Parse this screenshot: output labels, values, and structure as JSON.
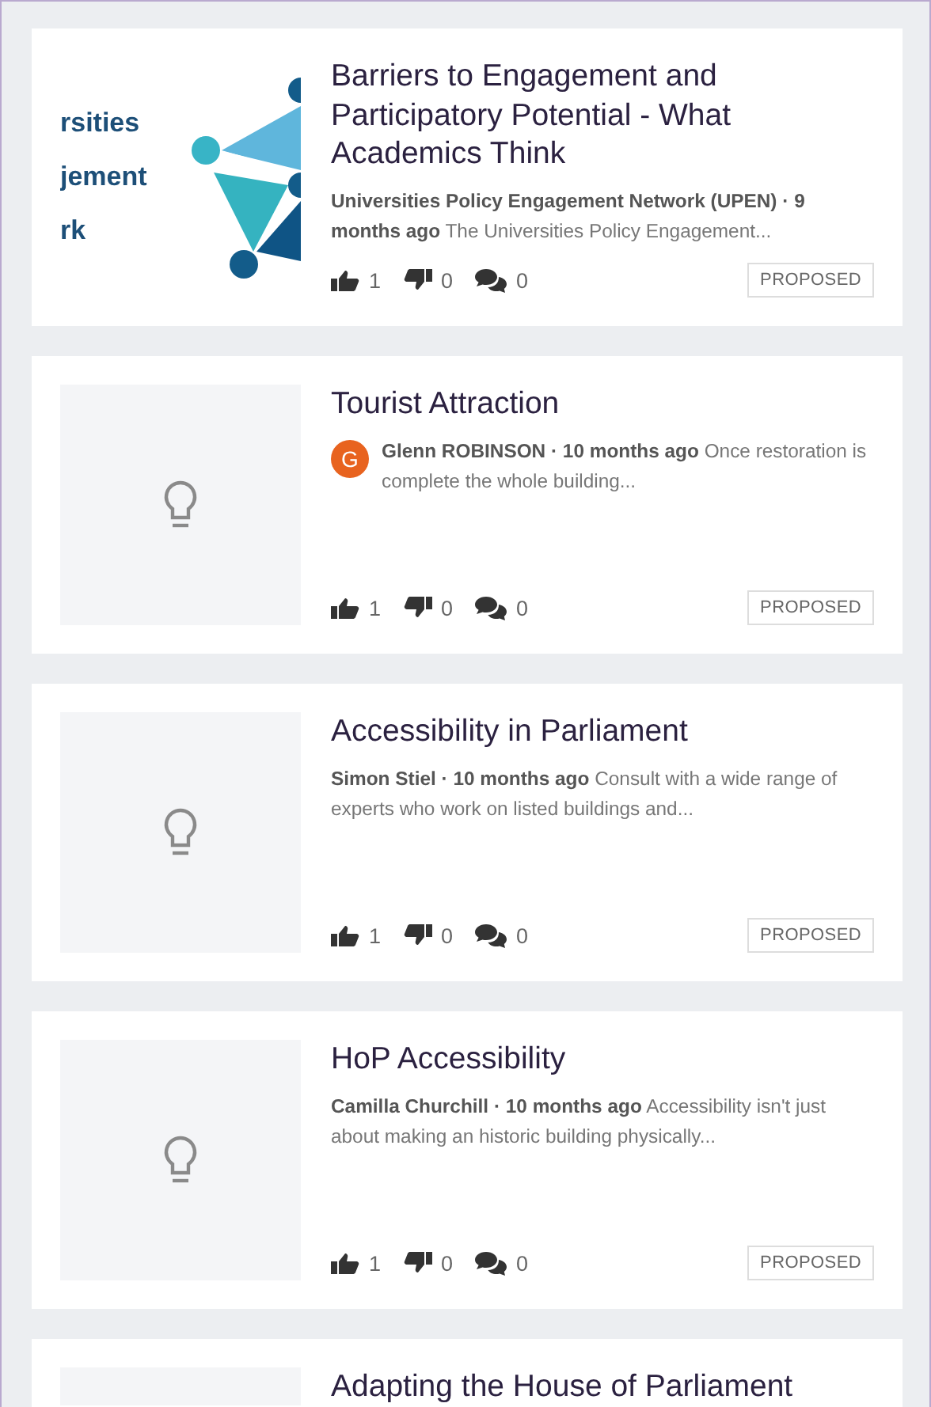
{
  "ideas": [
    {
      "title": "Barriers to Engagement and Participatory Potential - What Academics Think",
      "image": {
        "kind": "logo",
        "lines": [
          "rsities",
          "jement",
          "rk"
        ]
      },
      "meta": "**Universities Policy Engagement Network (UPEN) · 9 months ago** The Universities Policy Engagement...",
      "votes_up": "1",
      "votes_down": "0",
      "comments": "0",
      "status": "PROPOSED"
    },
    {
      "title": "Tourist Attraction",
      "image": {
        "kind": "placeholder"
      },
      "avatar": "G",
      "meta": "**Glenn ROBINSON · 10 months ago** Once restoration is complete the whole building...",
      "votes_up": "1",
      "votes_down": "0",
      "comments": "0",
      "status": "PROPOSED"
    },
    {
      "title": "Accessibility in Parliament",
      "image": {
        "kind": "placeholder"
      },
      "meta": "**Simon Stiel · 10 months ago** Consult with a wide range of experts who work on listed buildings and...",
      "votes_up": "1",
      "votes_down": "0",
      "comments": "0",
      "status": "PROPOSED"
    },
    {
      "title": "HoP Accessibility",
      "image": {
        "kind": "placeholder"
      },
      "meta": "**Camilla Churchill · 10 months ago** Accessibility isn't just about making an historic building physically...",
      "votes_up": "1",
      "votes_down": "0",
      "comments": "0",
      "status": "PROPOSED"
    },
    {
      "title": "Adapting the House of Parliament",
      "image": {
        "kind": "blank"
      }
    }
  ]
}
